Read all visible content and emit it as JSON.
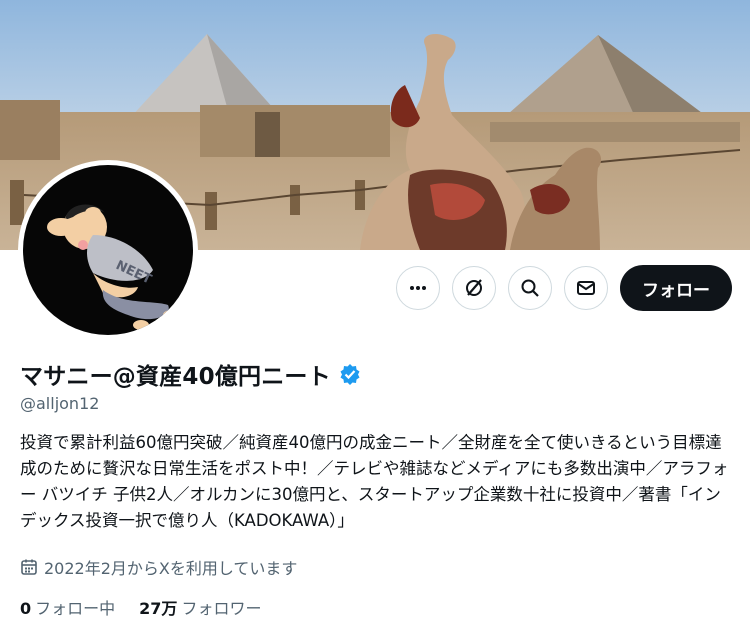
{
  "banner": {
    "description_icon": "pyramids-camels-photo"
  },
  "avatar": {
    "icon": "neet-character-avatar",
    "shirt_text": "NEET"
  },
  "actions": {
    "more_icon": "more-icon",
    "grok_icon": "grok-icon",
    "search_icon": "search-icon",
    "message_icon": "message-icon",
    "follow_label": "フォロー"
  },
  "profile": {
    "name": "マサニー@資産40億円ニート",
    "verified_icon": "verified-badge-icon",
    "verified_color": "#1d9bf0",
    "handle": "@alljon12",
    "bio": "投資で累計利益60億円突破／純資産40億円の成金ニート／全財産を全て使いきるという目標達成のために贅沢な日常生活をポスト中！／テレビや雑誌などメディアにも多数出演中／アラフォー バツイチ 子供2人／オルカンに30億円と、スタートアップ企業数十社に投資中／著書「インデックス投資一択で億り人（KADOKAWA）」",
    "joined_icon": "calendar-icon",
    "joined": "2022年2月からXを利用しています"
  },
  "stats": {
    "following_count": "0",
    "following_label": "フォロー中",
    "followers_count": "27万",
    "followers_label": "フォロワー"
  }
}
